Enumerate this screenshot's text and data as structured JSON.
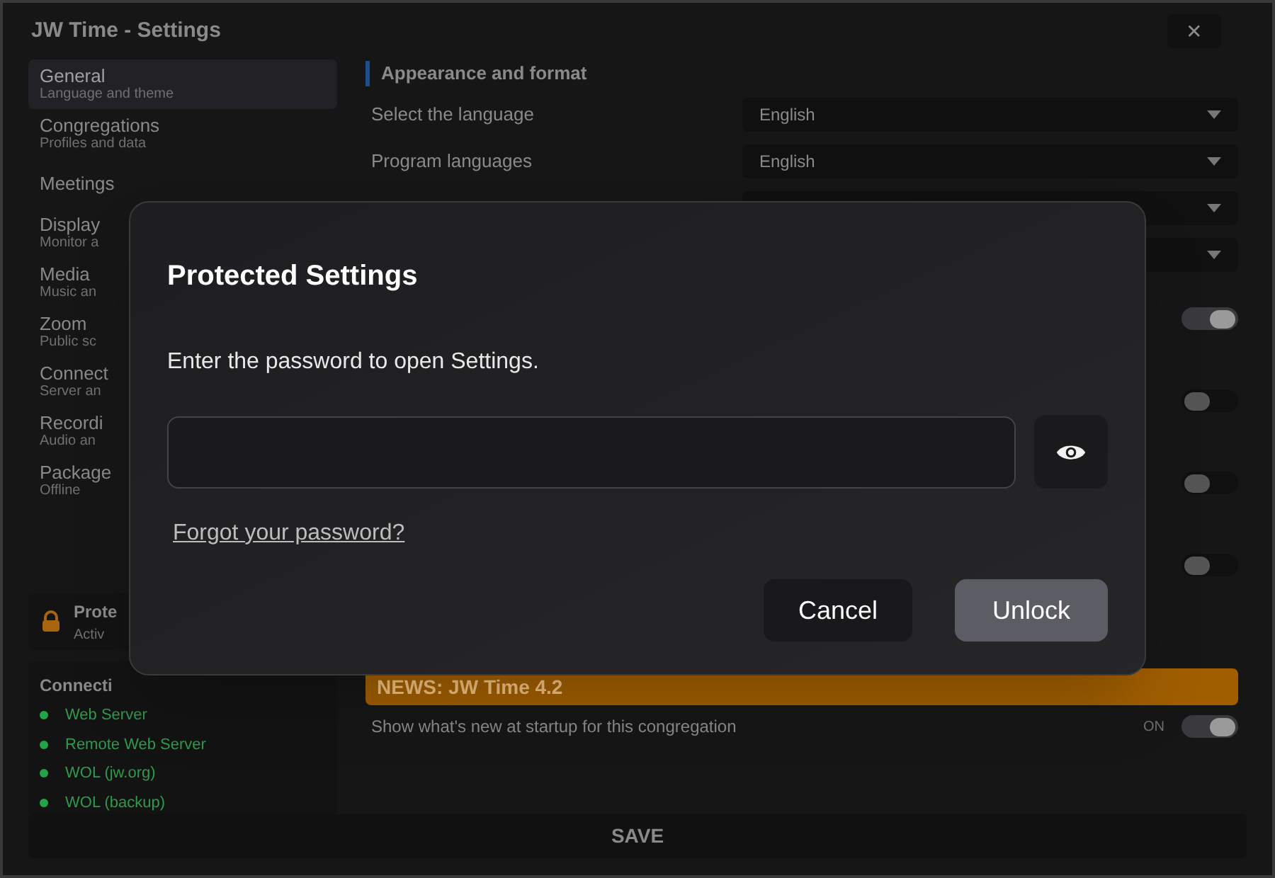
{
  "window": {
    "title": "JW Time - Settings",
    "close": "✕"
  },
  "sidebar": {
    "items": [
      {
        "label": "General",
        "sublabel": "Language and theme",
        "selected": true
      },
      {
        "label": "Congregations",
        "sublabel": "Profiles and data",
        "selected": false
      },
      {
        "label": "Meetings",
        "selected": false
      },
      {
        "label": "Display",
        "sublabel": "Monitor a",
        "selected": false
      },
      {
        "label": "Media",
        "sublabel": "Music an",
        "selected": false
      },
      {
        "label": "Zoom",
        "sublabel": "Public sc",
        "selected": false
      },
      {
        "label": "Connect",
        "sublabel": "Server an",
        "selected": false
      },
      {
        "label": "Recordi",
        "sublabel": "Audio an",
        "selected": false
      },
      {
        "label": "Package",
        "sublabel": "Offline",
        "selected": false
      }
    ],
    "protection": {
      "label": "Prote",
      "sublabel": "Activ"
    },
    "connections": {
      "title": "Connecti",
      "items": [
        {
          "label": "Web Server",
          "color": "#22a447"
        },
        {
          "label": "Remote Web Server",
          "color": "#22a447"
        },
        {
          "label": "WOL (jw.org)",
          "color": "#22a447"
        },
        {
          "label": "WOL (backup)",
          "color": "#22a447"
        }
      ]
    }
  },
  "content": {
    "section": "Appearance and format",
    "rows": [
      {
        "kind": "select",
        "label": "Select the language",
        "value": "English"
      },
      {
        "kind": "select",
        "label": "Program languages",
        "value": "English"
      },
      {
        "kind": "select"
      },
      {
        "kind": "select"
      },
      {
        "kind": "toggle",
        "on": true
      },
      {
        "kind": "toggle",
        "on": false
      },
      {
        "kind": "toggle",
        "on": false
      },
      {
        "kind": "toggle",
        "on": false
      }
    ],
    "news": {
      "title": "NEWS: JW Time 4.2",
      "label": "Show what's new at startup for this congregation",
      "state": "ON",
      "on": true
    }
  },
  "save_button": "SAVE",
  "dialog": {
    "title": "Protected Settings",
    "message": "Enter the password to open Settings.",
    "forgot_link": "Forgot your password?",
    "buttons": [
      {
        "label": "Cancel",
        "kind": "secondary"
      },
      {
        "label": "Unlock",
        "kind": "primary"
      }
    ]
  }
}
